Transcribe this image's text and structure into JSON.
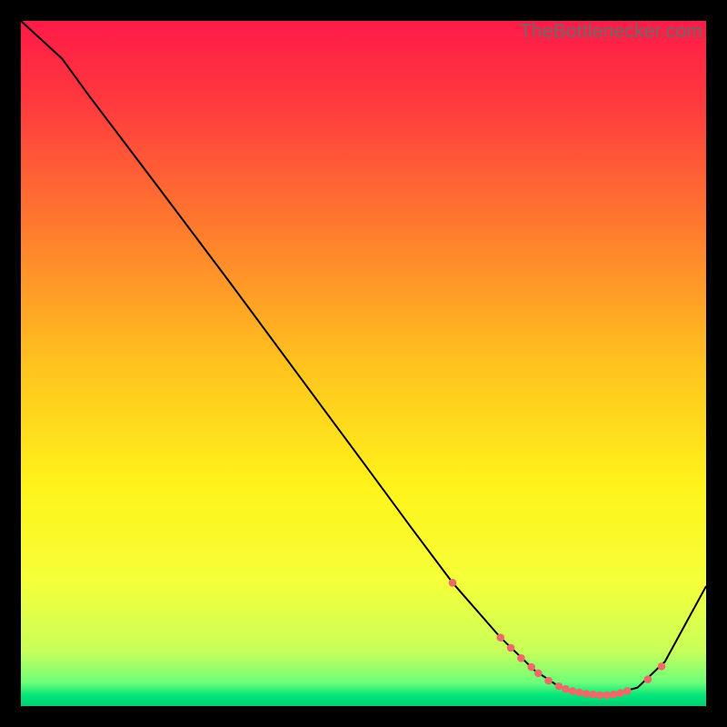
{
  "watermark": "TheBottlenecker.com",
  "chart_data": {
    "type": "line",
    "title": "",
    "xlabel": "",
    "ylabel": "",
    "xlim": [
      0,
      100
    ],
    "ylim": [
      0,
      100
    ],
    "grid": false,
    "background_gradient": {
      "stops": [
        {
          "offset": 0.0,
          "color": "#ff1a48"
        },
        {
          "offset": 0.12,
          "color": "#ff3a3e"
        },
        {
          "offset": 0.3,
          "color": "#ff7a2e"
        },
        {
          "offset": 0.5,
          "color": "#ffc21e"
        },
        {
          "offset": 0.68,
          "color": "#fff31a"
        },
        {
          "offset": 0.82,
          "color": "#f5ff3a"
        },
        {
          "offset": 0.92,
          "color": "#c8ff5a"
        },
        {
          "offset": 0.965,
          "color": "#6fff7a"
        },
        {
          "offset": 0.985,
          "color": "#00e57a"
        },
        {
          "offset": 1.0,
          "color": "#00cf72"
        }
      ]
    },
    "series": [
      {
        "name": "curve",
        "color": "#000000",
        "x": [
          0,
          6,
          10,
          20,
          30,
          40,
          50,
          57,
          63,
          70,
          75,
          78,
          80,
          83,
          86,
          90,
          94,
          100
        ],
        "y": [
          100,
          94.5,
          89,
          75.8,
          62.5,
          49,
          35.5,
          26,
          18,
          10,
          5.2,
          3.2,
          2.3,
          1.7,
          1.6,
          2.7,
          6.5,
          17.5
        ]
      }
    ],
    "markers": {
      "name": "dots",
      "color": "#ec6a6a",
      "radius_px": 4.3,
      "points": [
        {
          "x": 63,
          "y": 18
        },
        {
          "x": 70,
          "y": 10
        },
        {
          "x": 71.5,
          "y": 8.5
        },
        {
          "x": 73,
          "y": 7
        },
        {
          "x": 74.5,
          "y": 5.7
        },
        {
          "x": 75.5,
          "y": 4.8
        },
        {
          "x": 77,
          "y": 3.7
        },
        {
          "x": 78.5,
          "y": 2.9
        },
        {
          "x": 79.5,
          "y": 2.5
        },
        {
          "x": 80.5,
          "y": 2.2
        },
        {
          "x": 81.5,
          "y": 2.0
        },
        {
          "x": 82.5,
          "y": 1.8
        },
        {
          "x": 83.5,
          "y": 1.7
        },
        {
          "x": 84.5,
          "y": 1.6
        },
        {
          "x": 85.5,
          "y": 1.6
        },
        {
          "x": 86.5,
          "y": 1.7
        },
        {
          "x": 87.5,
          "y": 1.9
        },
        {
          "x": 88.5,
          "y": 2.2
        },
        {
          "x": 91.5,
          "y": 3.9
        },
        {
          "x": 93.5,
          "y": 5.8
        }
      ]
    }
  }
}
